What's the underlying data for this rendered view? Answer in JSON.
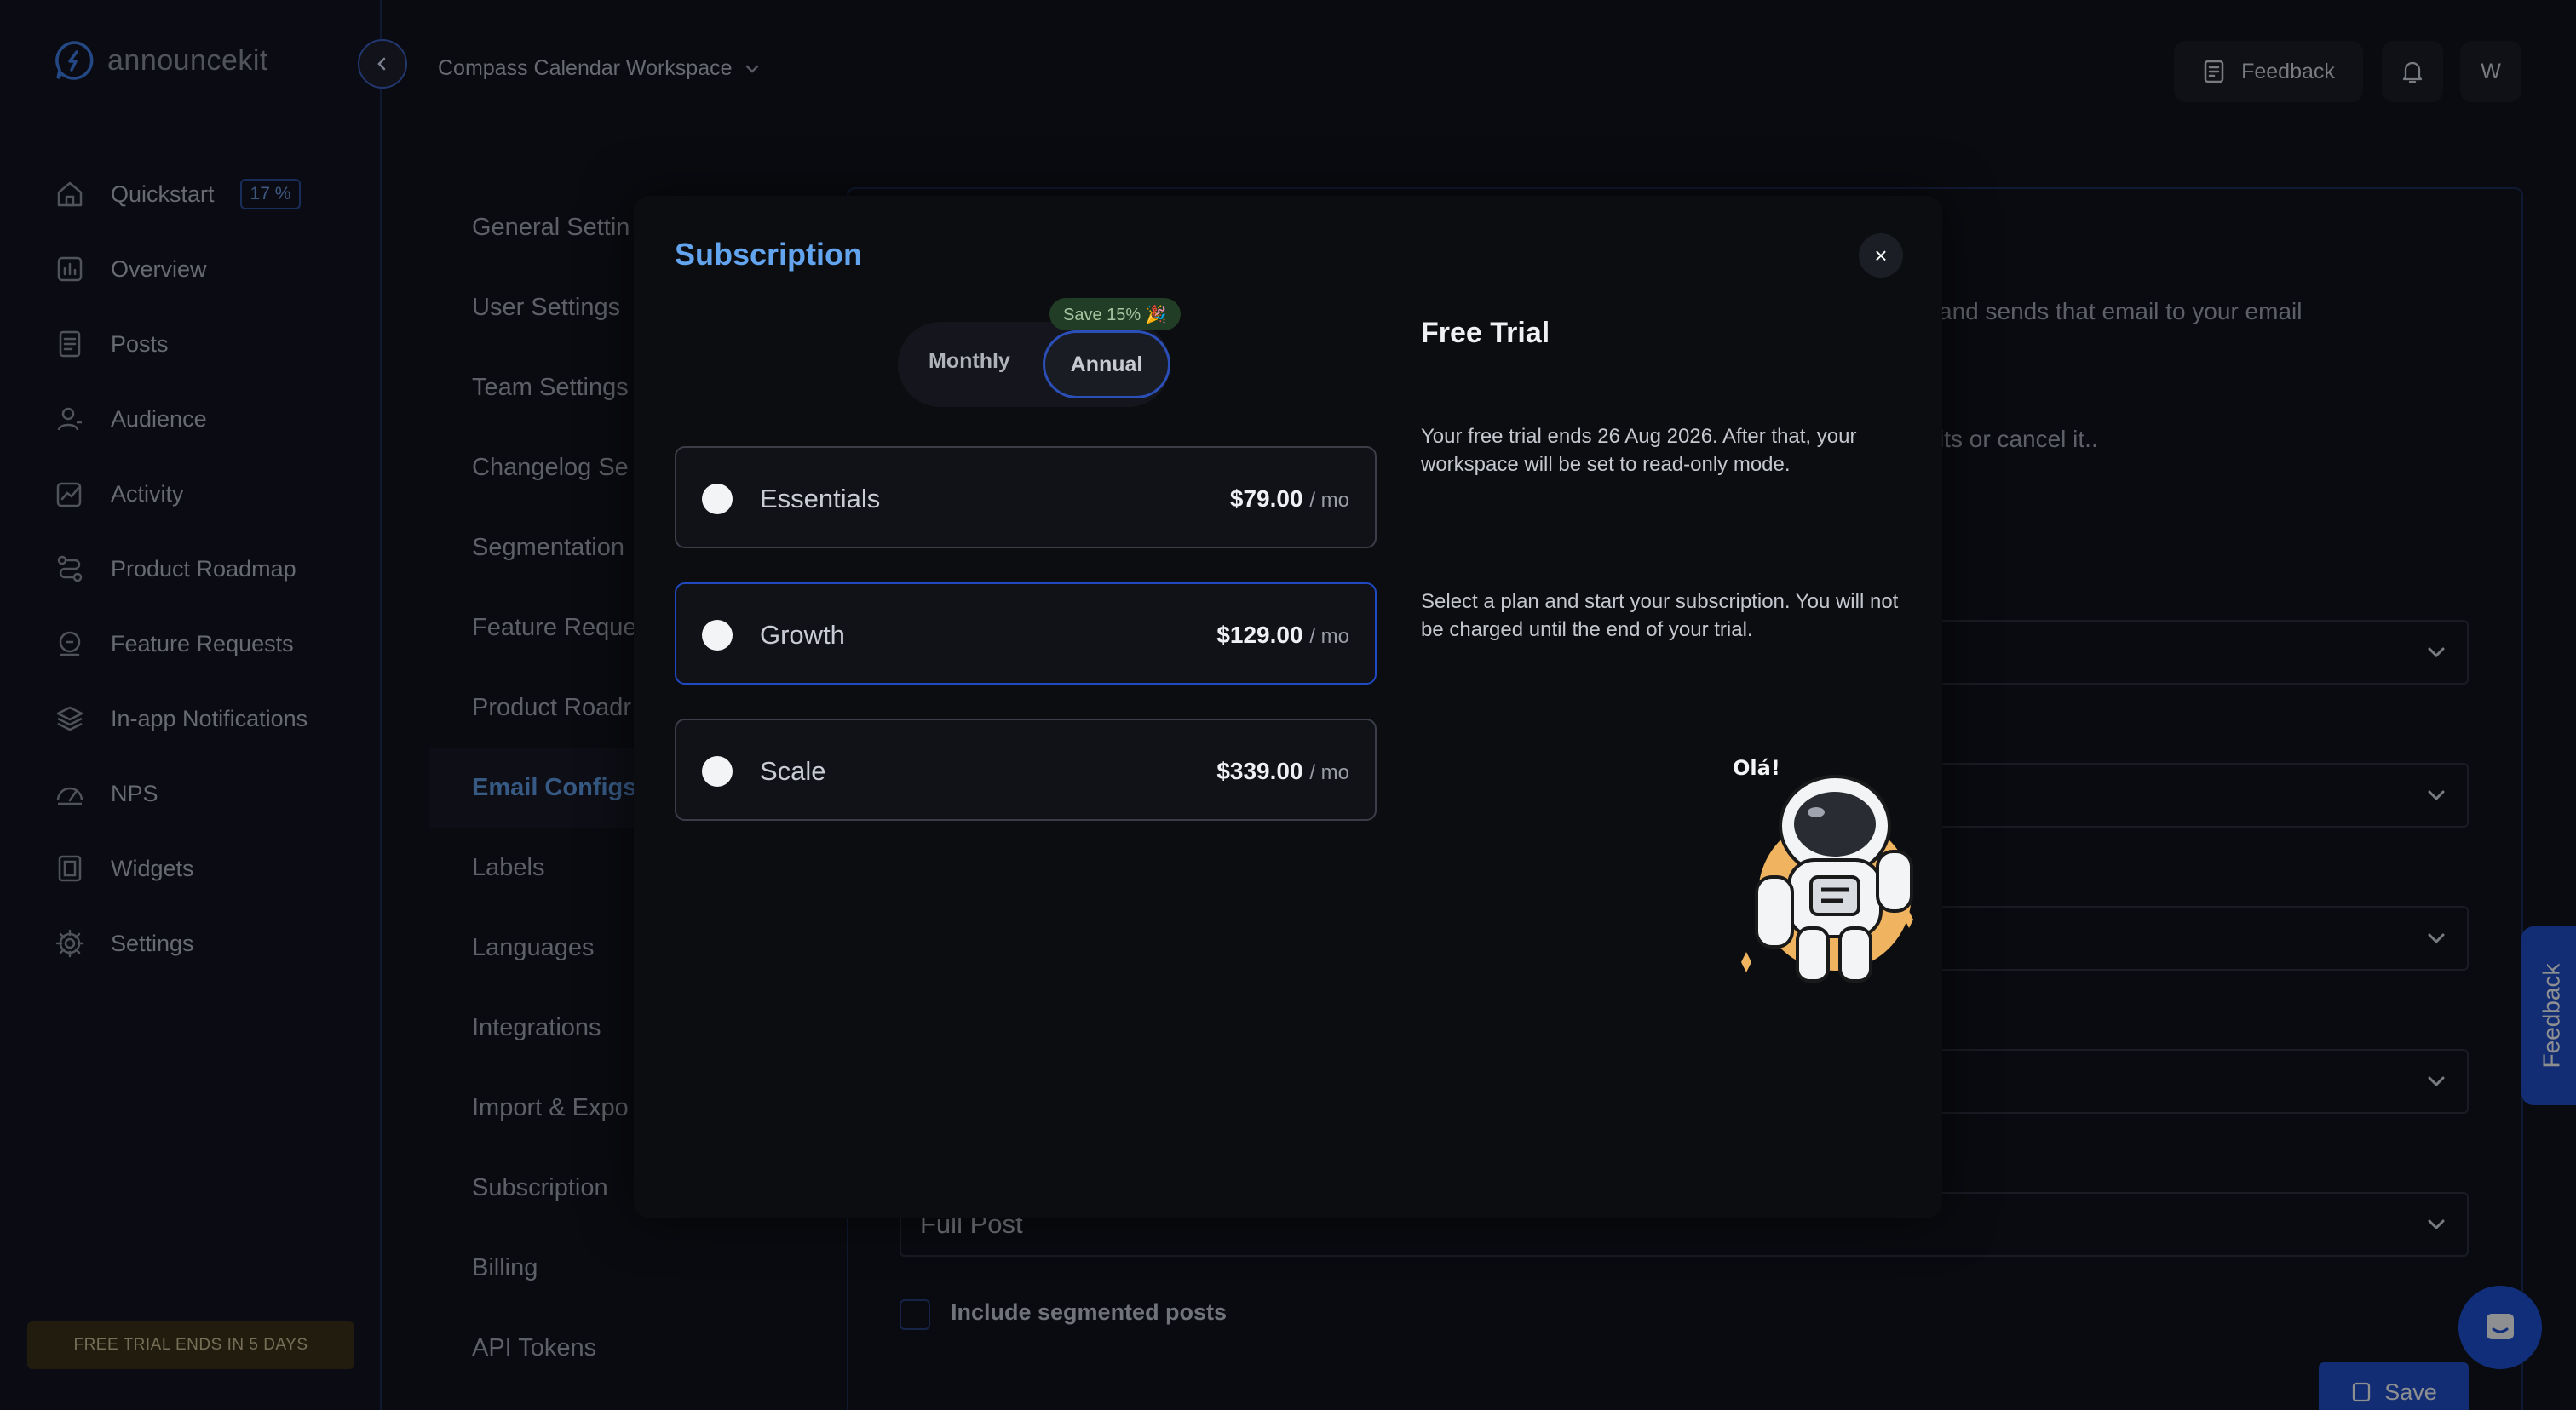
{
  "brand": {
    "name": "announcekit"
  },
  "topbar": {
    "workspace": "Compass Calendar Workspace",
    "feedback_label": "Feedback",
    "avatar_initial": "W"
  },
  "sidebar": {
    "items": [
      {
        "label": "Quickstart",
        "badge": "17 %"
      },
      {
        "label": "Overview"
      },
      {
        "label": "Posts"
      },
      {
        "label": "Audience"
      },
      {
        "label": "Activity"
      },
      {
        "label": "Product Roadmap"
      },
      {
        "label": "Feature Requests"
      },
      {
        "label": "In-app Notifications"
      },
      {
        "label": "NPS"
      },
      {
        "label": "Widgets"
      },
      {
        "label": "Settings"
      }
    ],
    "trial_banner": "FREE TRIAL ENDS IN 5 DAYS"
  },
  "settings_menu": {
    "items": [
      "General Settin",
      "User Settings",
      "Team Settings",
      "Changelog Se",
      "Segmentation",
      "Feature Reque",
      "Product Roadr",
      "Email Configs",
      "Labels",
      "Languages",
      "Integrations",
      "Import & Expo",
      "Subscription",
      "Billing",
      "API Tokens"
    ],
    "active_index": 7
  },
  "main": {
    "text_line1": "and sends that email to your email",
    "text_line2": "its or cancel it..",
    "full_post_value": "Full Post",
    "include_segmented_label": "Include segmented posts",
    "save_label": "Save",
    "side_feedback_label": "Feedback"
  },
  "modal": {
    "title": "Subscription",
    "close_label": "×",
    "billing_toggle": {
      "monthly": "Monthly",
      "annual": "Annual",
      "selected": "Annual",
      "save_badge": "Save 15% 🎉"
    },
    "plans": [
      {
        "name": "Essentials",
        "price": "$79.00",
        "period": "/ mo",
        "selected": false
      },
      {
        "name": "Growth",
        "price": "$129.00",
        "period": "/ mo",
        "selected": true
      },
      {
        "name": "Scale",
        "price": "$339.00",
        "period": "/ mo",
        "selected": false
      }
    ],
    "free_trial": {
      "title": "Free Trial",
      "text1": "Your free trial ends 26 Aug 2026. After that, your workspace will be set to read-only mode.",
      "text2": "Select a plan and start your subscription. You will not be charged until the end of your trial.",
      "illustration_caption": "Olá!"
    }
  }
}
